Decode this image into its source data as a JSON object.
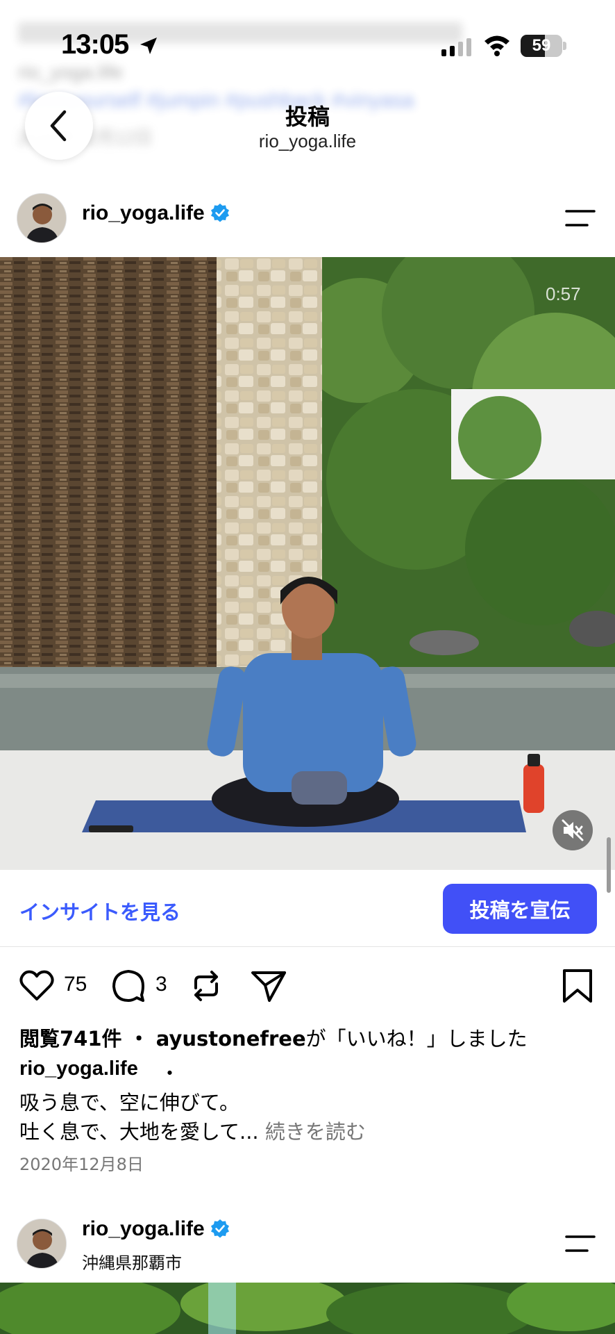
{
  "status_bar": {
    "time": "13:05",
    "battery": "59",
    "battery_level": 0.59
  },
  "nav": {
    "title": "投稿",
    "subtitle": "rio_yoga.life"
  },
  "background_ghost": {
    "line2": "rio_yoga.life",
    "line3": "#loveyourself #jumpin #pushback #vinyasa",
    "line4": "2020年12月12日"
  },
  "post": {
    "username": "rio_yoga.life",
    "video_timer": "0:57",
    "insights_label": "インサイトを見る",
    "promote_label": "投稿を宣伝",
    "likes": "75",
    "comments": "3",
    "views_prefix": "閲覧741件",
    "views_dot": "・",
    "liker": "ayustonefree",
    "liked_suffix": "が「いいね！」しました",
    "caption_user": "rio_yoga.life",
    "caption_dot": "・",
    "caption_line1": "吸う息で、空に伸びて。",
    "caption_line2": "吐く息で、大地を愛して...",
    "read_more": "続きを読む",
    "date": "2020年12月8日"
  },
  "next_post": {
    "username": "rio_yoga.life",
    "location": "沖縄県那覇市"
  },
  "colors": {
    "accent": "#3b5bfd",
    "promote_bg": "#4150f7",
    "verified": "#1d9bf0"
  },
  "icons": [
    "location-arrow-icon",
    "cellular-signal-icon",
    "wifi-icon",
    "back-chevron-icon",
    "verified-badge-icon",
    "more-options-icon",
    "mute-icon",
    "heart-icon",
    "comment-icon",
    "repost-icon",
    "share-icon",
    "bookmark-icon"
  ]
}
